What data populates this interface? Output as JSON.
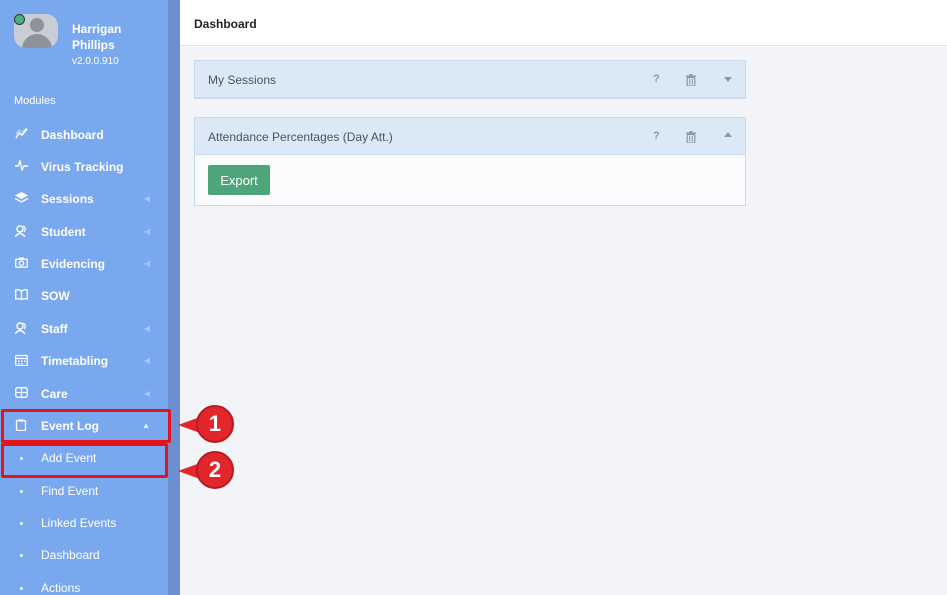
{
  "profile": {
    "name": "Harrigan Phillips",
    "version": "v2.0.0.910"
  },
  "sidebar": {
    "modules_label": "Modules",
    "items": [
      {
        "label": "Dashboard",
        "icon": "chart-line-icon"
      },
      {
        "label": "Virus Tracking",
        "icon": "pulse-icon"
      },
      {
        "label": "Sessions",
        "icon": "layers-icon"
      },
      {
        "label": "Student",
        "icon": "users-icon"
      },
      {
        "label": "Evidencing",
        "icon": "camera-icon"
      },
      {
        "label": "SOW",
        "icon": "book-icon"
      },
      {
        "label": "Staff",
        "icon": "users-icon"
      },
      {
        "label": "Timetabling",
        "icon": "calendar-icon"
      },
      {
        "label": "Care",
        "icon": "grid-icon"
      },
      {
        "label": "Event Log",
        "icon": "clipboard-icon"
      }
    ],
    "sub_items": [
      {
        "label": "Add Event"
      },
      {
        "label": "Find Event"
      },
      {
        "label": "Linked Events"
      },
      {
        "label": "Dashboard"
      },
      {
        "label": "Actions"
      }
    ]
  },
  "annotations": {
    "callout_1": "1",
    "callout_2": "2",
    "highlight_color": "#e3131c"
  },
  "header": {
    "title": "Dashboard"
  },
  "panels": [
    {
      "title": "My Sessions",
      "help": "?",
      "collapsed": true
    },
    {
      "title": "Attendance Percentages (Day Att.)",
      "help": "?",
      "collapsed": false,
      "button": "Export"
    }
  ],
  "colors": {
    "sidebar": "#7aa8ef",
    "panel_header": "#dbe9f7",
    "export_button": "#4ea57a"
  }
}
